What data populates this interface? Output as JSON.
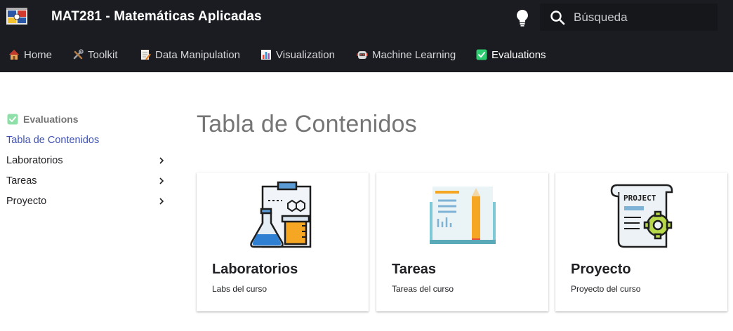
{
  "header": {
    "title": "MAT281 - Matemáticas Aplicadas",
    "search_placeholder": "Búsqueda",
    "logo_icon": "university-shield-logo",
    "theme_icon": "lightbulb-icon"
  },
  "tabs": [
    {
      "label": "Home",
      "icon": "house-icon",
      "active": false
    },
    {
      "label": "Toolkit",
      "icon": "tools-icon",
      "active": false
    },
    {
      "label": "Data Manipulation",
      "icon": "memo-icon",
      "active": false
    },
    {
      "label": "Visualization",
      "icon": "bar-chart-icon",
      "active": false
    },
    {
      "label": "Machine Learning",
      "icon": "robot-icon",
      "active": false
    },
    {
      "label": "Evaluations",
      "icon": "check-box-icon",
      "active": true
    }
  ],
  "sidebar": {
    "heading": "Evaluations",
    "items": [
      {
        "label": "Tabla de Contenidos",
        "active": true,
        "expandable": false
      },
      {
        "label": "Laboratorios",
        "active": false,
        "expandable": true
      },
      {
        "label": "Tareas",
        "active": false,
        "expandable": true
      },
      {
        "label": "Proyecto",
        "active": false,
        "expandable": true
      }
    ]
  },
  "main": {
    "title": "Tabla de Contenidos",
    "cards": [
      {
        "title": "Laboratorios",
        "description": "Labs del curso",
        "icon": "lab-flask-icon"
      },
      {
        "title": "Tareas",
        "description": "Tareas del curso",
        "icon": "book-pencil-icon"
      },
      {
        "title": "Proyecto",
        "description": "Proyecto del curso",
        "icon": "project-scroll-gear-icon"
      }
    ]
  },
  "colors": {
    "header_bg": "#1b1c21",
    "accent_link": "#3f51b5",
    "check_green": "#2ecc71"
  }
}
